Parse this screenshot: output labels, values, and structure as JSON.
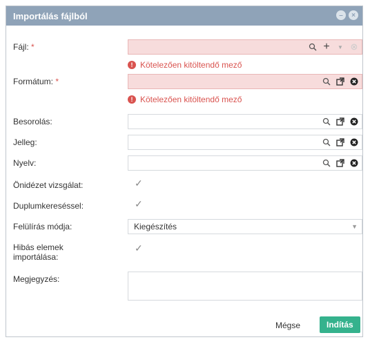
{
  "dialog": {
    "title": "Importálás fájlból",
    "required_mark": "*",
    "error_message": "Kötelezően kitöltendő mező",
    "fields": {
      "file_label": "Fájl:",
      "format_label": "Formátum:",
      "classification_label": "Besorolás:",
      "nature_label": "Jelleg:",
      "language_label": "Nyelv:",
      "selfcheck_label": "Önidézet vizsgálat:",
      "duplicate_label": "Duplumkereséssel:",
      "overwrite_label": "Felülírás módja:",
      "overwrite_value": "Kiegészítés",
      "faulty_label_line1": "Hibás elemek",
      "faulty_label_line2": "importálása:",
      "notes_label": "Megjegyzés:"
    },
    "buttons": {
      "cancel": "Mégse",
      "start": "Indítás"
    }
  }
}
